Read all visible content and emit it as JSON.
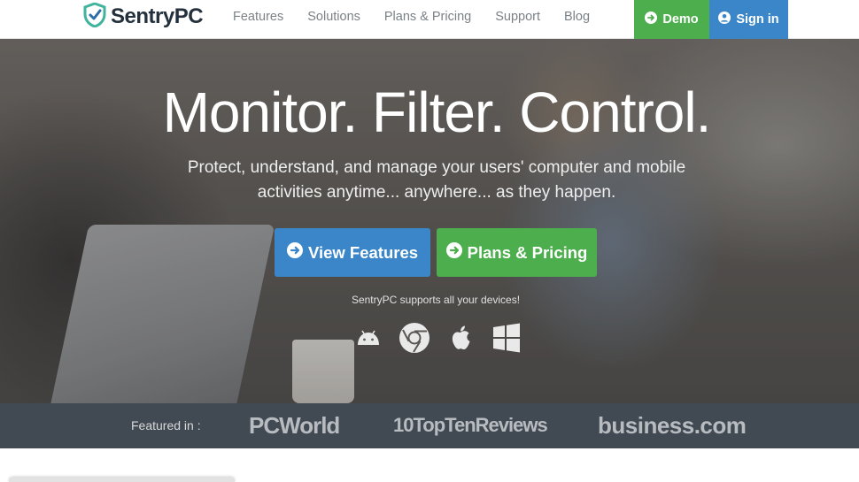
{
  "brand": {
    "name": "SentryPC",
    "accent_green": "#4cae4c",
    "accent_blue": "#3a86c8"
  },
  "nav": {
    "links": [
      "Features",
      "Solutions",
      "Plans & Pricing",
      "Support",
      "Blog"
    ],
    "demo_label": "Demo",
    "signin_label": "Sign in"
  },
  "hero": {
    "title": "Monitor. Filter. Control.",
    "subtitle": "Protect, understand, and manage your users' computer and mobile activities anytime... anywhere... as they happen.",
    "view_features_label": "View Features",
    "plans_pricing_label": "Plans & Pricing",
    "devices_text": "SentryPC supports all your devices!",
    "device_icons": [
      "android-icon",
      "chrome-icon",
      "apple-icon",
      "windows-icon"
    ]
  },
  "featured": {
    "label": "Featured in :",
    "publications": [
      "PCWorld",
      "TopTenReviews",
      "business.com"
    ]
  }
}
